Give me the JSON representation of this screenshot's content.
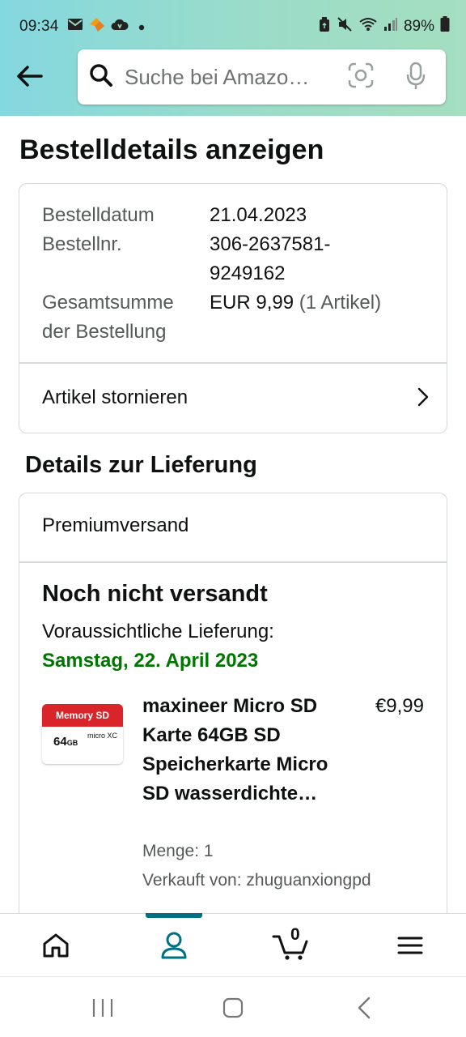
{
  "status_bar": {
    "time": "09:34",
    "battery": "89%",
    "icons": [
      "mail-icon",
      "app-notification-icon",
      "cloud-icon",
      "dot-icon",
      "recycle-icon",
      "mute-icon",
      "wifi-icon",
      "signal-icon",
      "battery-icon"
    ]
  },
  "search": {
    "placeholder": "Suche bei Amazo…"
  },
  "page": {
    "title": "Bestelldetails anzeigen"
  },
  "order_summary": {
    "date_label": "Bestelldatum",
    "date_value": "21.04.2023",
    "number_label": "Bestellnr.",
    "number_value_line1": "306-2637581-",
    "number_value_line2": "9249162",
    "total_label_line1": "Gesamtsumme",
    "total_label_line2": "der Bestellung",
    "total_value": "EUR 9,99",
    "total_items": "(1 Artikel)",
    "cancel_label": "Artikel stornieren"
  },
  "delivery": {
    "section_title": "Details zur Lieferung",
    "shipping_method": "Premiumversand",
    "status_title": "Noch nicht versandt",
    "eta_label": "Voraussichtliche Lieferung:",
    "eta_date": "Samstag, 22. April 2023"
  },
  "product": {
    "image_banner": "Memory SD",
    "image_capacity": "64",
    "image_capacity_unit": "GB",
    "image_logo": "micro XC",
    "title": "maxineer Micro SD Karte 64GB SD Speicherkarte Micro SD wasserdichte…",
    "price": "€9,99",
    "quantity": "Menge: 1",
    "seller": "Verkauft von: zhuguanxiongpd"
  },
  "bottom_nav": {
    "cart_count": "0",
    "active_tab": "account",
    "accent_color": "#007185"
  },
  "colors": {
    "delivery_date": "#007600",
    "header_gradient_start": "#84d8e0",
    "header_gradient_end": "#a5dec0"
  }
}
